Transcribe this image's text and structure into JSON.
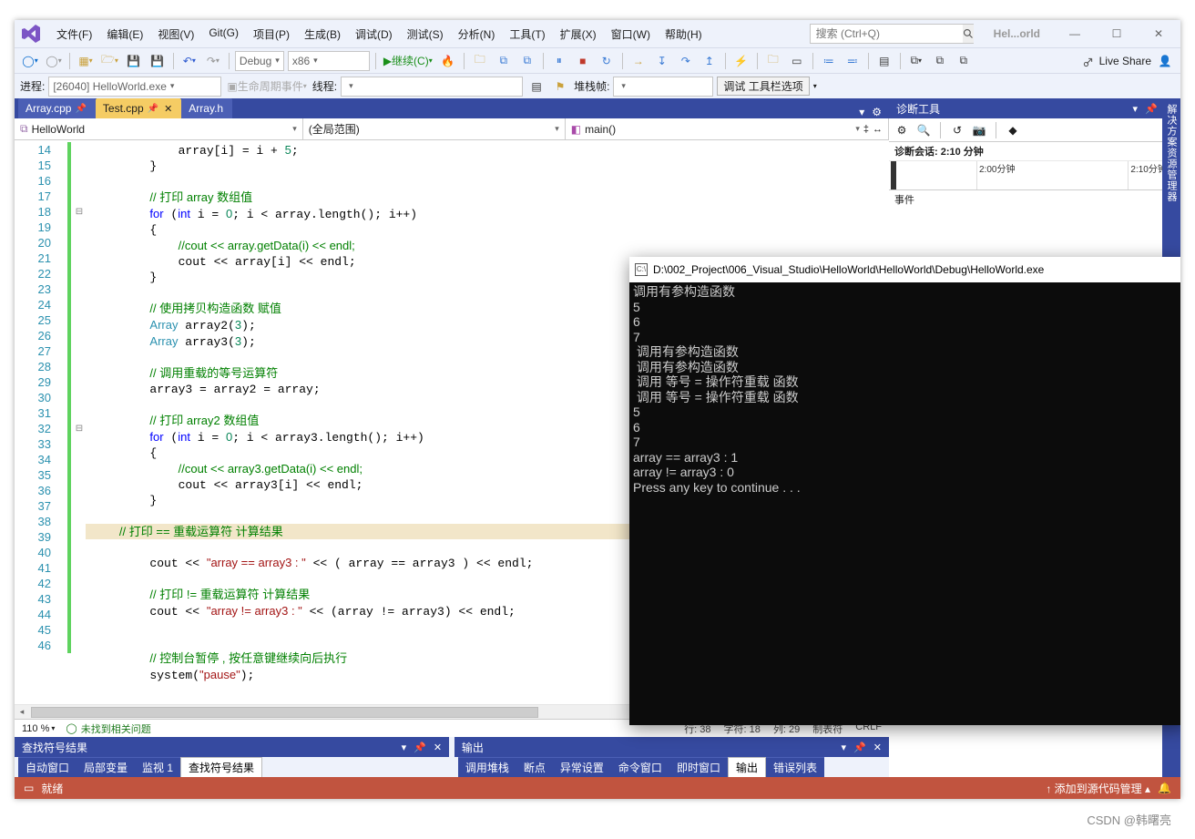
{
  "menus": {
    "file": "文件(F)",
    "edit": "编辑(E)",
    "view": "视图(V)",
    "git": "Git(G)",
    "project": "项目(P)",
    "build": "生成(B)",
    "debug": "调试(D)",
    "test": "测试(S)",
    "analyze": "分析(N)",
    "tools": "工具(T)",
    "extensions": "扩展(X)",
    "window": "窗口(W)",
    "help": "帮助(H)"
  },
  "search_placeholder": "搜索 (Ctrl+Q)",
  "solution_short": "Hel...orld",
  "toolbar": {
    "config": "Debug",
    "platform": "x86",
    "continue": "继续(C)",
    "live_share": "Live Share"
  },
  "toolbar2": {
    "process_label": "进程:",
    "process": "[26040] HelloWorld.exe",
    "lifecycle": "生命周期事件",
    "thread_label": "线程:",
    "stackframe_label": "堆栈帧:",
    "debug_options": "调试 工具栏选项"
  },
  "tabs": [
    {
      "name": "Array.cpp",
      "pinned": true,
      "active": false
    },
    {
      "name": "Test.cpp",
      "pinned": true,
      "active": true
    },
    {
      "name": "Array.h",
      "pinned": false,
      "active": false
    }
  ],
  "scopes": {
    "project": "HelloWorld",
    "scope": "(全局范围)",
    "func": "main()"
  },
  "code": {
    "lines": [
      {
        "n": 14,
        "fold": "",
        "html": "            array[i] = i + <span class='c-num'>5</span>;"
      },
      {
        "n": 15,
        "fold": "",
        "html": "        }"
      },
      {
        "n": 16,
        "fold": "",
        "html": ""
      },
      {
        "n": 17,
        "fold": "",
        "html": "        <span class='c-com'>// 打印 array 数组值</span>"
      },
      {
        "n": 18,
        "fold": "⊟",
        "html": "        <span class='c-key'>for</span> (<span class='c-key'>int</span> i = <span class='c-num'>0</span>; i &lt; array.length(); i++)"
      },
      {
        "n": 19,
        "fold": "",
        "html": "        {"
      },
      {
        "n": 20,
        "fold": "",
        "html": "            <span class='c-com'>//cout &lt;&lt; array.getData(i) &lt;&lt; endl;</span>"
      },
      {
        "n": 21,
        "fold": "",
        "html": "            cout &lt;&lt; array[i] &lt;&lt; endl;"
      },
      {
        "n": 22,
        "fold": "",
        "html": "        }"
      },
      {
        "n": 23,
        "fold": "",
        "html": ""
      },
      {
        "n": 24,
        "fold": "",
        "html": "        <span class='c-com'>// 使用拷贝构造函数 赋值</span>"
      },
      {
        "n": 25,
        "fold": "",
        "html": "        <span class='c-type'>Array</span> array2(<span class='c-num'>3</span>);"
      },
      {
        "n": 26,
        "fold": "",
        "html": "        <span class='c-type'>Array</span> array3(<span class='c-num'>3</span>);"
      },
      {
        "n": 27,
        "fold": "",
        "html": ""
      },
      {
        "n": 28,
        "fold": "",
        "html": "        <span class='c-com'>// 调用重载的等号运算符</span>"
      },
      {
        "n": 29,
        "fold": "",
        "html": "        array3 = array2 = array;"
      },
      {
        "n": 30,
        "fold": "",
        "html": ""
      },
      {
        "n": 31,
        "fold": "",
        "html": "        <span class='c-com'>// 打印 array2 数组值</span>"
      },
      {
        "n": 32,
        "fold": "⊟",
        "html": "        <span class='c-key'>for</span> (<span class='c-key'>int</span> i = <span class='c-num'>0</span>; i &lt; array3.length(); i++)"
      },
      {
        "n": 33,
        "fold": "",
        "html": "        {"
      },
      {
        "n": 34,
        "fold": "",
        "html": "            <span class='c-com'>//cout &lt;&lt; array3.getData(i) &lt;&lt; endl;</span>"
      },
      {
        "n": 35,
        "fold": "",
        "html": "            cout &lt;&lt; array3[i] &lt;&lt; endl;"
      },
      {
        "n": 36,
        "fold": "",
        "html": "        }"
      },
      {
        "n": 37,
        "fold": "",
        "html": ""
      },
      {
        "n": 38,
        "fold": "",
        "hl": true,
        "html": "        <span class='c-com'>// 打印 == 重载运算符 计算结果</span>"
      },
      {
        "n": 39,
        "fold": "",
        "html": "        cout &lt;&lt; <span class='c-str'>\"array == array3 : \"</span> &lt;&lt; ( array == array3 ) &lt;&lt; endl;"
      },
      {
        "n": 40,
        "fold": "",
        "html": ""
      },
      {
        "n": 41,
        "fold": "",
        "html": "        <span class='c-com'>// 打印 != 重载运算符 计算结果</span>"
      },
      {
        "n": 42,
        "fold": "",
        "html": "        cout &lt;&lt; <span class='c-str'>\"array != array3 : \"</span> &lt;&lt; (array != array3) &lt;&lt; endl;"
      },
      {
        "n": 43,
        "fold": "",
        "html": ""
      },
      {
        "n": 44,
        "fold": "",
        "html": ""
      },
      {
        "n": 45,
        "fold": "",
        "html": "        <span class='c-com'>// 控制台暂停 , 按任意键继续向后执行</span>"
      },
      {
        "n": 46,
        "fold": "",
        "html": "        system(<span class='c-str'>\"pause\"</span>);"
      }
    ]
  },
  "editor_status": {
    "zoom": "110 %",
    "issues": "未找到相关问题",
    "line": "行: 38",
    "char": "字符: 18",
    "col": "列: 29",
    "tabs": "制表符",
    "eol": "CRLF"
  },
  "diag": {
    "title": "诊断工具",
    "session": "诊断会话: 2:10 分钟",
    "tick1": "2:00分钟",
    "tick2": "2:10分钟",
    "events": "事件"
  },
  "right_rail": "解决方案资源管理器",
  "bottom_left": {
    "title": "查找符号结果",
    "tabs": [
      "自动窗口",
      "局部变量",
      "监视 1",
      "查找符号结果"
    ]
  },
  "bottom_right": {
    "title": "输出",
    "tabs": [
      "调用堆栈",
      "断点",
      "异常设置",
      "命令窗口",
      "即时窗口",
      "输出",
      "错误列表"
    ]
  },
  "status": {
    "ready": "就绪",
    "source_control": "添加到源代码管理"
  },
  "console": {
    "title": "D:\\002_Project\\006_Visual_Studio\\HelloWorld\\HelloWorld\\Debug\\HelloWorld.exe",
    "lines": [
      "调用有参构造函数",
      "5",
      "6",
      "7",
      " 调用有参构造函数",
      " 调用有参构造函数",
      " 调用 等号 = 操作符重载 函数",
      " 调用 等号 = 操作符重载 函数",
      "5",
      "6",
      "7",
      "array == array3 : 1",
      "array != array3 : 0",
      "Press any key to continue . . ."
    ]
  },
  "watermark": "CSDN @韩曙亮"
}
